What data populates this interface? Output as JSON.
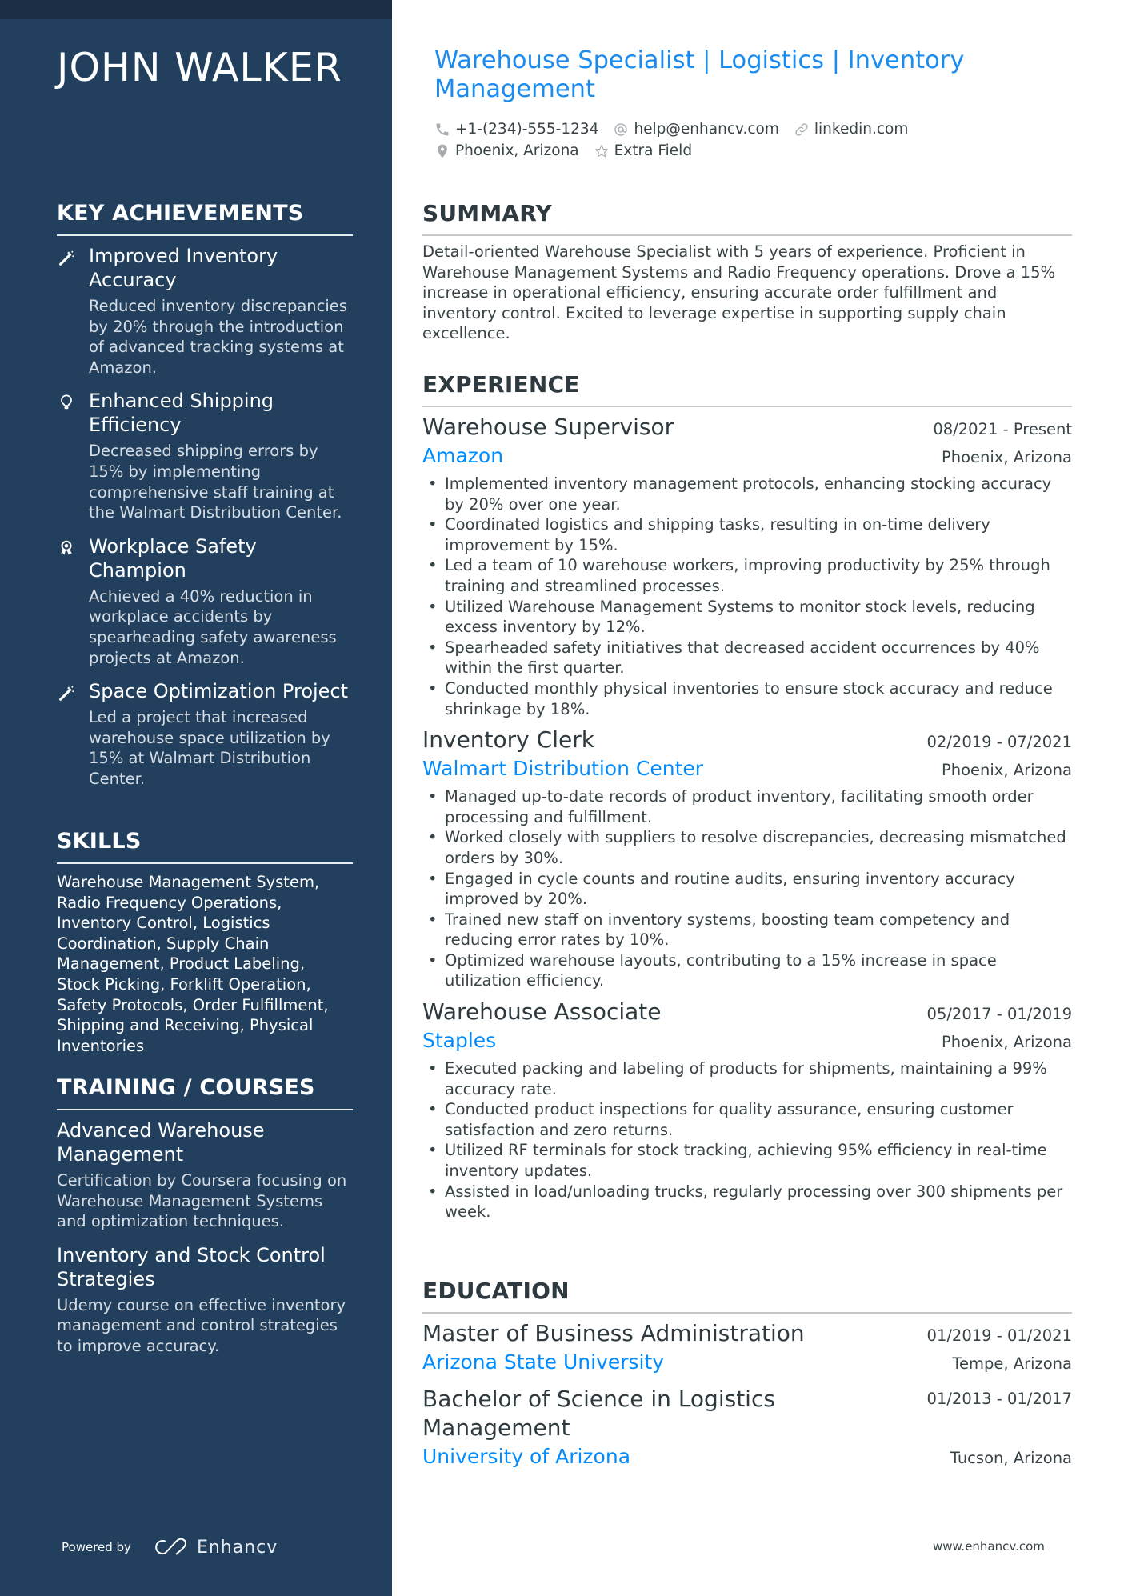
{
  "name": "JOHN WALKER",
  "headline": "Warehouse Specialist | Logistics | Inventory Management",
  "contacts": {
    "phone": {
      "icon": "phone-icon",
      "text": "+1-(234)-555-1234"
    },
    "email": {
      "icon": "at-icon",
      "text": "help@enhancv.com"
    },
    "link": {
      "icon": "link-icon",
      "text": "linkedin.com"
    },
    "location": {
      "icon": "location-pin-icon",
      "text": "Phoenix, Arizona"
    },
    "extra": {
      "icon": "star-icon",
      "text": "Extra Field"
    }
  },
  "sidebar": {
    "achievements": {
      "heading": "KEY ACHIEVEMENTS",
      "items": [
        {
          "icon": "magic-wand-icon",
          "title": "Improved Inventory Accuracy",
          "desc": "Reduced inventory discrepancies by 20% through the introduction of advanced tracking systems at Amazon."
        },
        {
          "icon": "lightbulb-icon",
          "title": "Enhanced Shipping Efficiency",
          "desc": "Decreased shipping errors by 15% by implementing comprehensive staff training at the Walmart Distribution Center."
        },
        {
          "icon": "award-ribbon-icon",
          "title": "Workplace Safety Champion",
          "desc": "Achieved a 40% reduction in workplace accidents by spearheading safety awareness projects at Amazon."
        },
        {
          "icon": "magic-wand-icon",
          "title": "Space Optimization Project",
          "desc": "Led a project that increased warehouse space utilization by 15% at Walmart Distribution Center."
        }
      ]
    },
    "skills": {
      "heading": "SKILLS",
      "text": "Warehouse Management System, Radio Frequency Operations, Inventory Control, Logistics Coordination, Supply Chain Management, Product Labeling, Stock Picking, Forklift Operation, Safety Protocols, Order Fulfillment, Shipping and Receiving, Physical Inventories"
    },
    "training": {
      "heading": "TRAINING / COURSES",
      "items": [
        {
          "title": "Advanced Warehouse Management",
          "desc": "Certification by Coursera focusing on Warehouse Management Systems and optimization techniques."
        },
        {
          "title": "Inventory and Stock Control Strategies",
          "desc": "Udemy course on effective inventory management and control strategies to improve accuracy."
        }
      ]
    },
    "powered_by": "Powered by",
    "brand": "Enhancv"
  },
  "summary": {
    "heading": "SUMMARY",
    "text": "Detail-oriented Warehouse Specialist with 5 years of experience. Proficient in Warehouse Management Systems and Radio Frequency operations. Drove a 15% increase in operational efficiency, ensuring accurate order fulfillment and inventory control. Excited to leverage expertise in supporting supply chain excellence."
  },
  "experience": {
    "heading": "EXPERIENCE",
    "jobs": [
      {
        "title": "Warehouse Supervisor",
        "dates": "08/2021 - Present",
        "company": "Amazon",
        "location": "Phoenix, Arizona",
        "bullets": [
          "Implemented inventory management protocols, enhancing stocking accuracy by 20% over one year.",
          "Coordinated logistics and shipping tasks, resulting in on-time delivery improvement by 15%.",
          "Led a team of 10 warehouse workers, improving productivity by 25% through training and streamlined processes.",
          "Utilized Warehouse Management Systems to monitor stock levels, reducing excess inventory by 12%.",
          "Spearheaded safety initiatives that decreased accident occurrences by 40% within the first quarter.",
          "Conducted monthly physical inventories to ensure stock accuracy and reduce shrinkage by 18%."
        ]
      },
      {
        "title": "Inventory Clerk",
        "dates": "02/2019 - 07/2021",
        "company": "Walmart Distribution Center",
        "location": "Phoenix, Arizona",
        "bullets": [
          "Managed up-to-date records of product inventory, facilitating smooth order processing and fulfillment.",
          "Worked closely with suppliers to resolve discrepancies, decreasing mismatched orders by 30%.",
          "Engaged in cycle counts and routine audits, ensuring inventory accuracy improved by 20%.",
          "Trained new staff on inventory systems, boosting team competency and reducing error rates by 10%.",
          "Optimized warehouse layouts, contributing to a 15% increase in space utilization efficiency."
        ]
      },
      {
        "title": "Warehouse Associate",
        "dates": "05/2017 - 01/2019",
        "company": "Staples",
        "location": "Phoenix, Arizona",
        "bullets": [
          "Executed packing and labeling of products for shipments, maintaining a 99% accuracy rate.",
          "Conducted product inspections for quality assurance, ensuring customer satisfaction and zero returns.",
          "Utilized RF terminals for stock tracking, achieving 95% efficiency in real-time inventory updates.",
          "Assisted in load/unloading trucks, regularly processing over 300 shipments per week."
        ]
      }
    ]
  },
  "education": {
    "heading": "EDUCATION",
    "items": [
      {
        "degree": "Master of Business Administration",
        "dates": "01/2019 - 01/2021",
        "school": "Arizona State University",
        "location": "Tempe, Arizona"
      },
      {
        "degree": "Bachelor of Science in Logistics Management",
        "dates": "01/2013 - 01/2017",
        "school": "University of Arizona",
        "location": "Tucson, Arizona"
      }
    ]
  },
  "footer": {
    "website": "www.enhancv.com"
  },
  "colors": {
    "sidebar": "#22405e",
    "sidebar_strip": "#1c2e45",
    "accent": "#008cff",
    "text": "#384347"
  }
}
